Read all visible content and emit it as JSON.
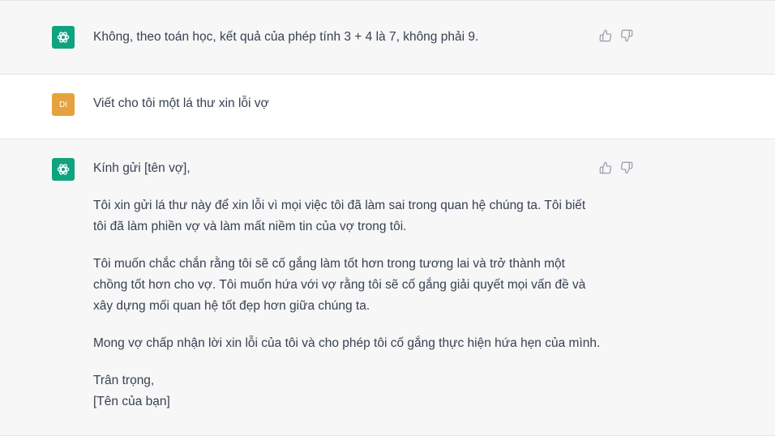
{
  "conversation": {
    "messages": [
      {
        "role": "assistant",
        "icon": "openai-logo-icon",
        "paragraphs": [
          "Không, theo toán học, kết quả của phép tính 3 + 4 là 7, không phải 9."
        ]
      },
      {
        "role": "user",
        "avatar_initials": "DI",
        "paragraphs": [
          "Viết cho tôi một lá thư xin lỗi vợ"
        ]
      },
      {
        "role": "assistant",
        "icon": "openai-logo-icon",
        "paragraphs": [
          "Kính gửi [tên vợ],",
          "Tôi xin gửi lá thư này để xin lỗi vì mọi việc tôi đã làm sai trong quan hệ chúng ta. Tôi biết tôi đã làm phiền vợ và làm mất niềm tin của vợ trong tôi.",
          "Tôi muốn chắc chắn rằng tôi sẽ cố gắng làm tốt hơn trong tương lai và trở thành một chồng tốt hơn cho vợ. Tôi muốn hứa với vợ rằng tôi sẽ cố gắng giải quyết mọi vấn đề và xây dựng mối quan hệ tốt đẹp hơn giữa chúng ta.",
          "Mong vợ chấp nhận lời xin lỗi của tôi và cho phép tôi cố gắng thực hiện hứa hẹn của mình.",
          "Trân trọng,\n[Tên của bạn]"
        ]
      }
    ]
  },
  "colors": {
    "assistant_bg": "#f7f7f8",
    "user_bg": "#ffffff",
    "gpt_green": "#10a37f",
    "user_avatar": "#e6a23c",
    "text": "#374151"
  },
  "icons": {
    "thumbs_up": "thumbs-up-icon",
    "thumbs_down": "thumbs-down-icon"
  }
}
